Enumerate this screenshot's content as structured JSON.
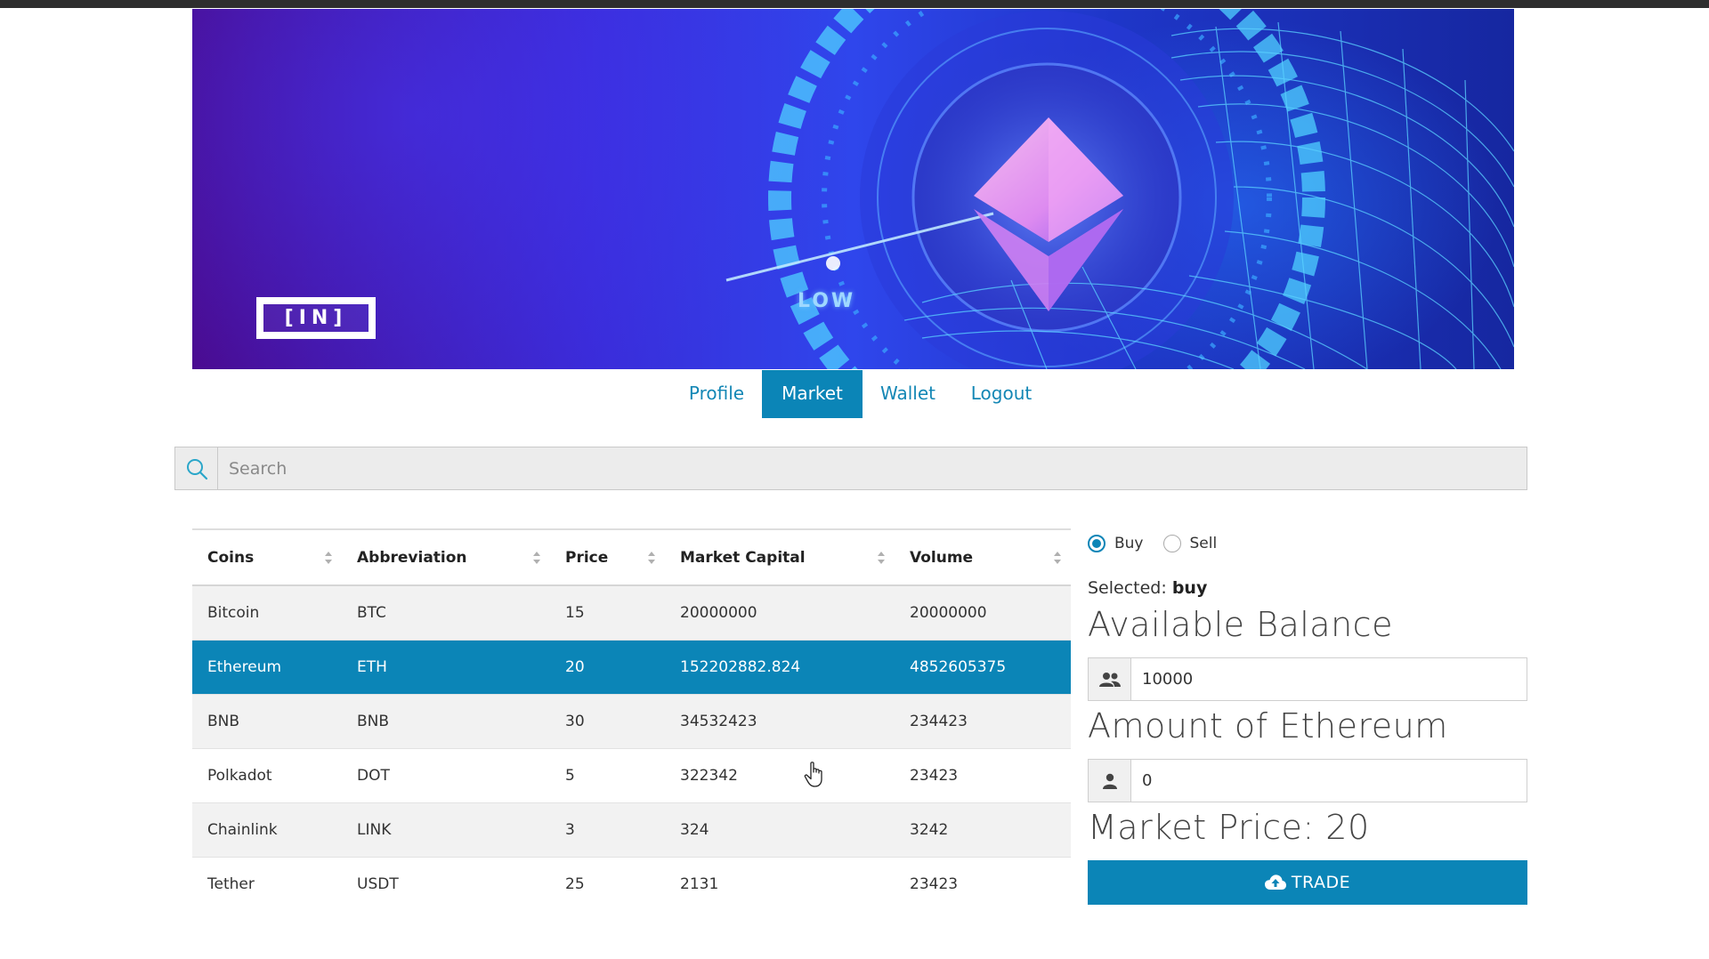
{
  "banner": {
    "logo_text": "[IN]",
    "low_label": "LOW"
  },
  "nav": {
    "items": [
      {
        "label": "Profile",
        "active": false
      },
      {
        "label": "Market",
        "active": true
      },
      {
        "label": "Wallet",
        "active": false
      },
      {
        "label": "Logout",
        "active": false
      }
    ]
  },
  "search": {
    "placeholder": "Search",
    "value": ""
  },
  "table": {
    "columns": [
      "Coins",
      "Abbreviation",
      "Price",
      "Market Capital",
      "Volume"
    ],
    "rows": [
      {
        "coin": "Bitcoin",
        "abbr": "BTC",
        "price": "15",
        "market_cap": "20000000",
        "volume": "20000000"
      },
      {
        "coin": "Ethereum",
        "abbr": "ETH",
        "price": "20",
        "market_cap": "152202882.824",
        "volume": "4852605375"
      },
      {
        "coin": "BNB",
        "abbr": "BNB",
        "price": "30",
        "market_cap": "34532423",
        "volume": "234423"
      },
      {
        "coin": "Polkadot",
        "abbr": "DOT",
        "price": "5",
        "market_cap": "322342",
        "volume": "23423"
      },
      {
        "coin": "Chainlink",
        "abbr": "LINK",
        "price": "3",
        "market_cap": "324",
        "volume": "3242"
      },
      {
        "coin": "Tether",
        "abbr": "USDT",
        "price": "25",
        "market_cap": "2131",
        "volume": "23423"
      }
    ],
    "selected_row": "Ethereum"
  },
  "panel": {
    "radio_buy": "Buy",
    "radio_sell": "Sell",
    "radio_selected": "buy",
    "selected_prefix": "Selected:",
    "selected_value": "buy",
    "available_balance_title": "Available Balance",
    "balance_value": "10000",
    "amount_title": "Amount of Ethereum",
    "amount_value": "0",
    "market_price": "Market Price: 20",
    "trade_button": "TRADE"
  },
  "colors": {
    "accent": "#0b85b7",
    "nav_link": "#1487b5",
    "row_stripe": "#f2f2f2"
  }
}
